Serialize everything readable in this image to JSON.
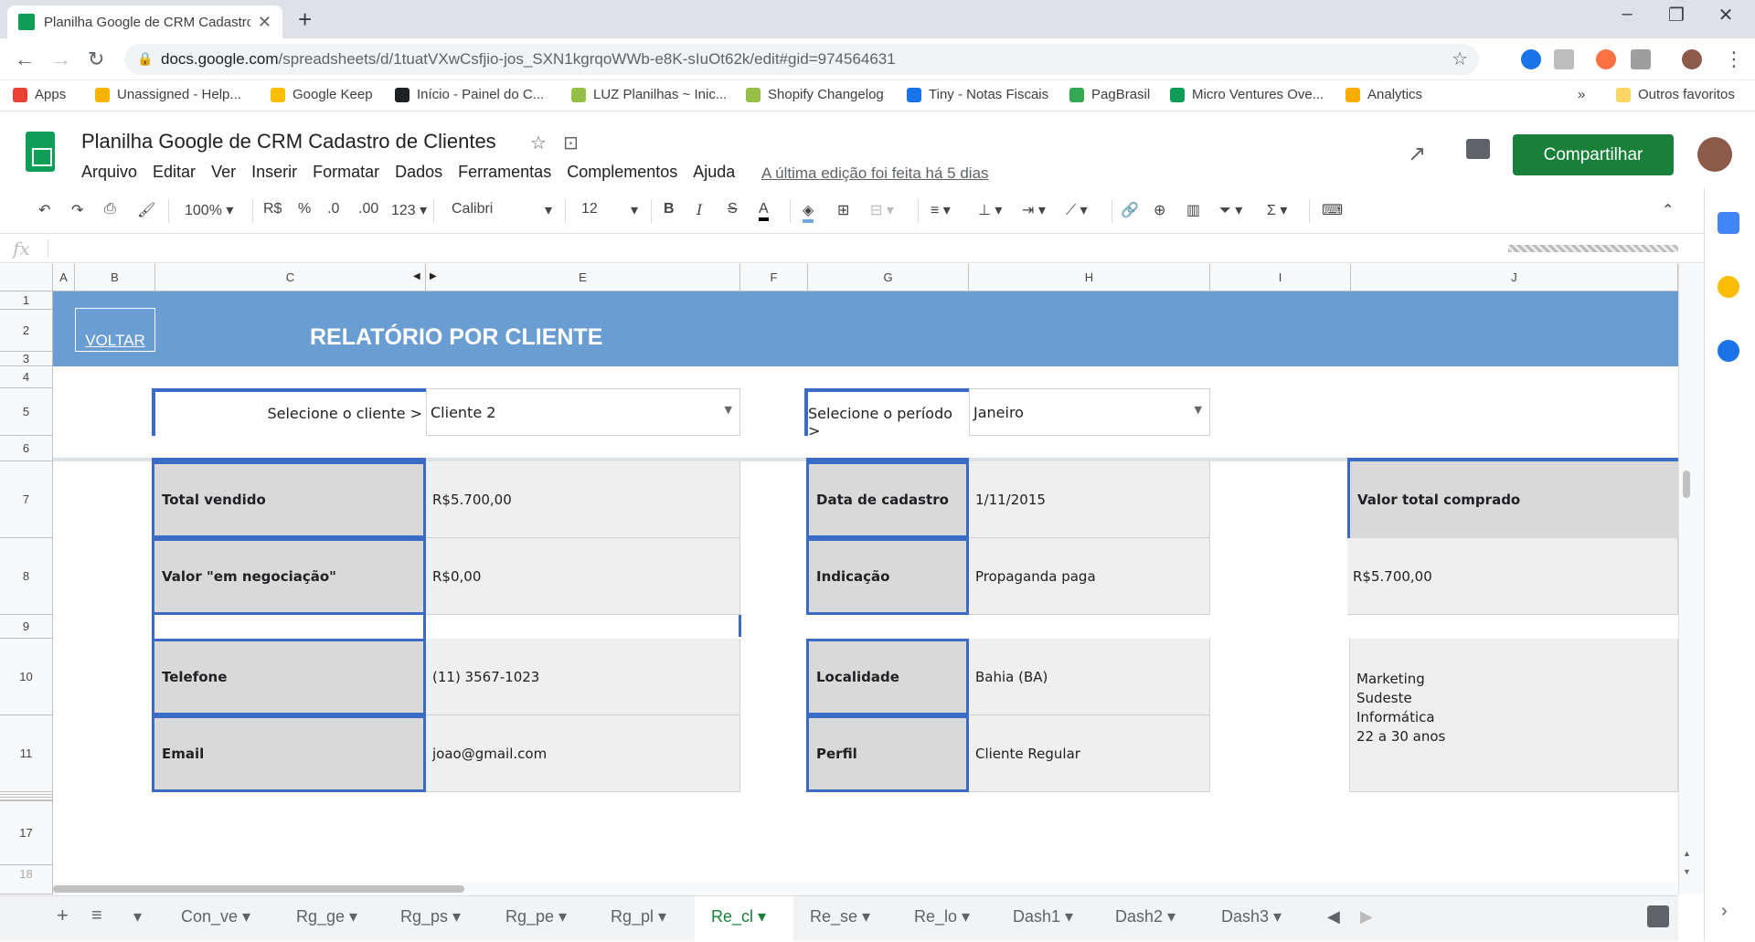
{
  "browser": {
    "tab_title": "Planilha Google de CRM Cadastro",
    "url_prefix": "docs.google.com",
    "url_path": "/spreadsheets/d/1tuatVXwCsfjio-jos_SXN1kgrqoWWb-e8K-sIuOt62k/edit#gid=974564631",
    "bookmarks": [
      "Apps",
      "Unassigned - Help...",
      "Google Keep",
      "Início - Painel do C...",
      "LUZ Planilhas ~ Inic...",
      "Shopify Changelog",
      "Tiny - Notas Fiscais",
      "PagBrasil",
      "Micro Ventures Ove...",
      "Analytics"
    ],
    "bookmarks_more": "»",
    "other_favorites": "Outros favoritos"
  },
  "sheets": {
    "doc_title": "Planilha  Google de CRM Cadastro de Clientes",
    "menu": [
      "Arquivo",
      "Editar",
      "Ver",
      "Inserir",
      "Formatar",
      "Dados",
      "Ferramentas",
      "Complementos",
      "Ajuda"
    ],
    "last_edit": "A última edição foi feita há 5 dias",
    "share_label": "Compartilhar"
  },
  "toolbar": {
    "zoom": "100%",
    "currency": "R$",
    "percent": "%",
    "dec_less": ".0",
    "dec_more": ".00",
    "more_formats": "123",
    "font": "Calibri",
    "font_size": "12"
  },
  "grid": {
    "columns": [
      "A",
      "B",
      "C",
      "E",
      "F",
      "G",
      "H",
      "I",
      "J"
    ],
    "rows": [
      "1",
      "2",
      "3",
      "4",
      "5",
      "6",
      "7",
      "8",
      "9",
      "10",
      "11",
      "17",
      "18"
    ],
    "voltar": "VOLTAR",
    "report_title": "RELATÓRIO POR CLIENTE",
    "select_client_label": "Selecione o cliente >",
    "select_client_value": "Cliente 2",
    "select_period_label": "Selecione o período >",
    "select_period_value": "Janeiro",
    "left_block": [
      {
        "label": "Total vendido",
        "value": "R$5.700,00"
      },
      {
        "label": "Valor \"em negociação\"",
        "value": "R$0,00"
      },
      {
        "label": "Telefone",
        "value": "(11) 3567-1023"
      },
      {
        "label": "Email",
        "value": "joao@gmail.com"
      }
    ],
    "middle_block": [
      {
        "label": "Data de cadastro",
        "value": "1/11/2015"
      },
      {
        "label": "Indicação",
        "value": "Propaganda paga"
      },
      {
        "label": "Localidade",
        "value": "Bahia (BA)"
      },
      {
        "label": "Perfil",
        "value": "Cliente Regular"
      }
    ],
    "right_block": {
      "label": "Valor total comprado",
      "value": "R$5.700,00",
      "segments": [
        "Marketing",
        "Sudeste",
        "Informática",
        "22 a 30 anos"
      ]
    }
  },
  "sheet_tabs": [
    "Con_ve",
    "Rg_ge",
    "Rg_ps",
    "Rg_pe",
    "Rg_pl",
    "Re_cl",
    "Re_se",
    "Re_lo",
    "Dash1",
    "Dash2",
    "Dash3"
  ],
  "active_tab": "Re_cl",
  "colors": {
    "banner": "#6a9dd1",
    "share": "#188038",
    "accent_border": "#3b6cc5"
  }
}
